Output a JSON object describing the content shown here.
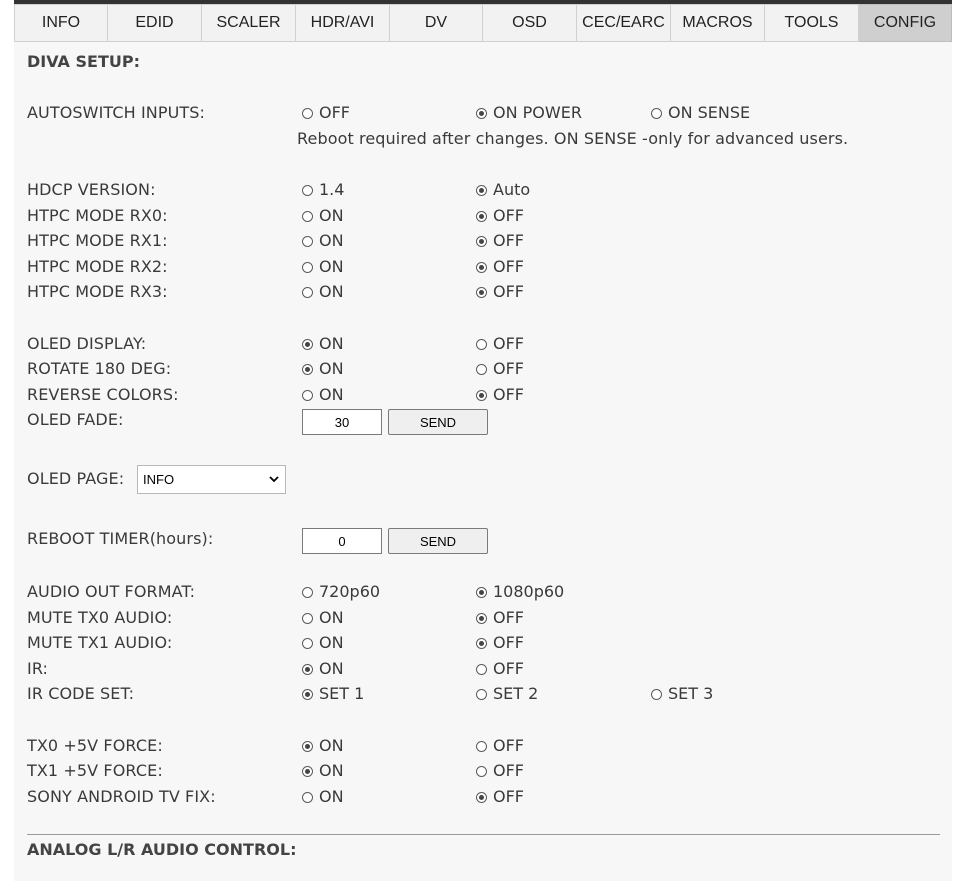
{
  "tabs": [
    "INFO",
    "EDID",
    "SCALER",
    "HDR/AVI",
    "DV",
    "OSD",
    "CEC/EARC",
    "MACROS",
    "TOOLS",
    "CONFIG"
  ],
  "active_tab": "CONFIG",
  "section_title": "DIVA SETUP:",
  "autoswitch": {
    "label": "AUTOSWITCH INPUTS:",
    "options": [
      {
        "label": "OFF",
        "checked": false
      },
      {
        "label": "ON POWER",
        "checked": true
      },
      {
        "label": "ON SENSE",
        "checked": false
      }
    ],
    "note": "Reboot required after changes. ON SENSE -only for advanced users."
  },
  "rows": [
    {
      "label": "HDCP VERSION:",
      "options": [
        {
          "label": "1.4",
          "checked": false
        },
        {
          "label": "Auto",
          "checked": true
        }
      ]
    },
    {
      "label": "HTPC MODE RX0:",
      "options": [
        {
          "label": "ON",
          "checked": false
        },
        {
          "label": "OFF",
          "checked": true
        }
      ]
    },
    {
      "label": "HTPC MODE RX1:",
      "options": [
        {
          "label": "ON",
          "checked": false
        },
        {
          "label": "OFF",
          "checked": true
        }
      ]
    },
    {
      "label": "HTPC MODE RX2:",
      "options": [
        {
          "label": "ON",
          "checked": false
        },
        {
          "label": "OFF",
          "checked": true
        }
      ]
    },
    {
      "label": "HTPC MODE RX3:",
      "options": [
        {
          "label": "ON",
          "checked": false
        },
        {
          "label": "OFF",
          "checked": true
        }
      ]
    },
    {
      "label": "OLED DISPLAY:",
      "options": [
        {
          "label": "ON",
          "checked": true
        },
        {
          "label": "OFF",
          "checked": false
        }
      ]
    },
    {
      "label": "ROTATE 180 DEG:",
      "options": [
        {
          "label": "ON",
          "checked": true
        },
        {
          "label": "OFF",
          "checked": false
        }
      ]
    },
    {
      "label": "REVERSE COLORS:",
      "options": [
        {
          "label": "ON",
          "checked": false
        },
        {
          "label": "OFF",
          "checked": true
        }
      ]
    },
    {
      "label": "AUDIO OUT FORMAT:",
      "options": [
        {
          "label": "720p60",
          "checked": false
        },
        {
          "label": "1080p60",
          "checked": true
        }
      ]
    },
    {
      "label": "MUTE TX0 AUDIO:",
      "options": [
        {
          "label": "ON",
          "checked": false
        },
        {
          "label": "OFF",
          "checked": true
        }
      ]
    },
    {
      "label": "MUTE TX1 AUDIO:",
      "options": [
        {
          "label": "ON",
          "checked": false
        },
        {
          "label": "OFF",
          "checked": true
        }
      ]
    },
    {
      "label": "IR:",
      "options": [
        {
          "label": "ON",
          "checked": true
        },
        {
          "label": "OFF",
          "checked": false
        }
      ]
    },
    {
      "label": "IR CODE SET:",
      "options": [
        {
          "label": "SET 1",
          "checked": true
        },
        {
          "label": "SET 2",
          "checked": false
        },
        {
          "label": "SET 3",
          "checked": false
        }
      ]
    },
    {
      "label": "TX0 +5V FORCE:",
      "options": [
        {
          "label": "ON",
          "checked": true
        },
        {
          "label": "OFF",
          "checked": false
        }
      ]
    },
    {
      "label": "TX1 +5V FORCE:",
      "options": [
        {
          "label": "ON",
          "checked": true
        },
        {
          "label": "OFF",
          "checked": false
        }
      ]
    },
    {
      "label": "SONY ANDROID TV FIX:",
      "options": [
        {
          "label": "ON",
          "checked": false
        },
        {
          "label": "OFF",
          "checked": true
        }
      ]
    }
  ],
  "oled_fade": {
    "label": "OLED FADE:",
    "value": "30",
    "button": "SEND"
  },
  "oled_page": {
    "label": "OLED PAGE:",
    "selected": "INFO"
  },
  "reboot_timer": {
    "label": "REBOOT TIMER(hours):",
    "value": "0",
    "button": "SEND"
  },
  "section2_title": "ANALOG L/R AUDIO CONTROL:"
}
